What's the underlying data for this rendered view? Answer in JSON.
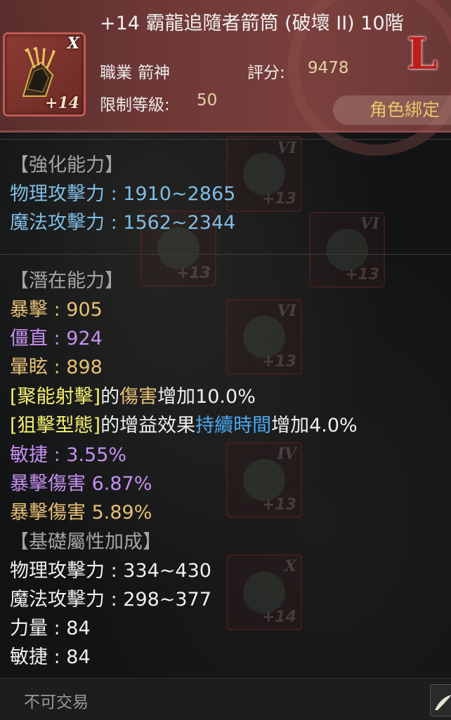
{
  "header": {
    "title": "+14 霸龍追隨者箭筒 (破壞 II) 10階",
    "slot": {
      "tier": "X",
      "plus": "+14"
    },
    "class_label": "職業",
    "class_value": "箭神",
    "score_label": "評分:",
    "score_value": "9478",
    "level_label": "限制等級:",
    "level_value": "50",
    "rank": "L",
    "bind_text": "角色綁定"
  },
  "enhance": {
    "heading": "【強化能力】",
    "stats": [
      "物理攻擊力 : 1910~2865",
      "魔法攻擊力 : 1562~2344"
    ]
  },
  "potential": {
    "heading": "【潛在能力】",
    "crit": "暴擊 : 905",
    "stiff": "僵直 : 924",
    "stun": "暈眩 : 898",
    "skill1": {
      "name": "[聚能射擊]",
      "mid": "的",
      "key": "傷害",
      "tail": "增加10.0%"
    },
    "skill2": {
      "name": "[狙擊型態]",
      "mid": "的增益效果",
      "key": "持續時間",
      "tail": "增加4.0%"
    },
    "agility_pct": "敏捷 : 3.55%",
    "crit_dmg_1": "暴擊傷害 6.87%",
    "crit_dmg_2": "暴擊傷害 5.89%"
  },
  "base": {
    "heading": "【基礎屬性加成】",
    "stats": [
      "物理攻擊力 : 334~430",
      "魔法攻擊力 : 298~377",
      "力量 : 84",
      "敏捷 : 84"
    ]
  },
  "footer": {
    "trade_text": "不可交易"
  },
  "background_slots": [
    {
      "tier": "VI",
      "plus": "+13"
    },
    {
      "tier": "",
      "plus": "+13"
    },
    {
      "tier": "VI",
      "plus": "+13"
    },
    {
      "tier": "VI",
      "plus": "+13"
    },
    {
      "tier": "IV",
      "plus": "+13"
    },
    {
      "tier": "X",
      "plus": "+14"
    }
  ],
  "colors": {
    "header_bg": "#6e3836",
    "stat_blue": "#7fbde4",
    "stat_gold": "#e8c074",
    "stat_purple": "#c690f0",
    "rank_red": "#c01c1c"
  }
}
